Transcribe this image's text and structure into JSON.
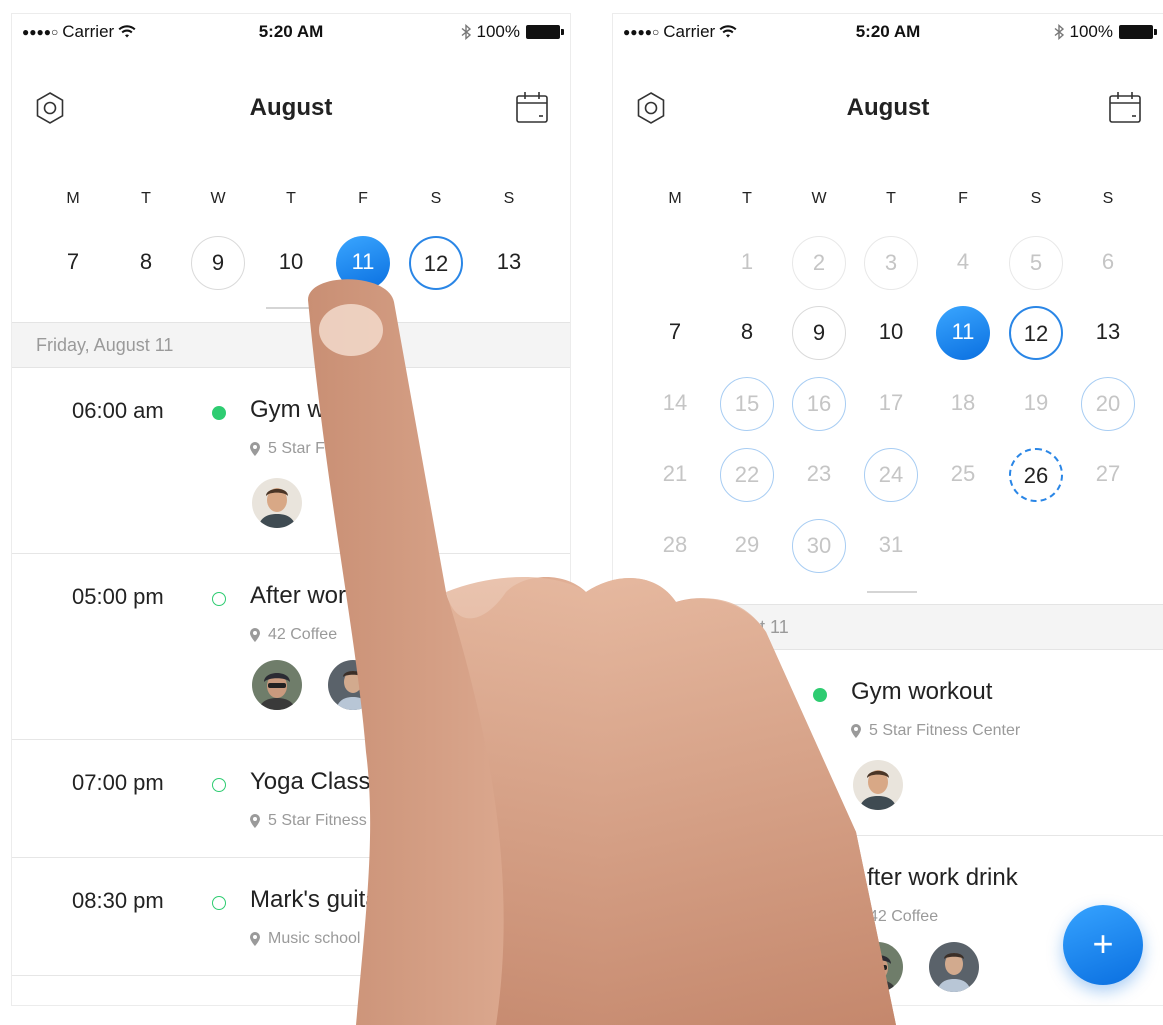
{
  "status_bar": {
    "signal_dots": "●●●●○",
    "carrier": "Carrier",
    "time": "5:20 AM",
    "battery": "100%"
  },
  "nav": {
    "title": "August",
    "left_icon": "settings-hexagon-icon",
    "right_icon": "calendar-icon"
  },
  "weekdays": [
    "M",
    "T",
    "W",
    "T",
    "F",
    "S",
    "S"
  ],
  "left_screen": {
    "week_days": [
      "7",
      "8",
      "9",
      "10",
      "11",
      "12",
      "13"
    ],
    "section_header": "Friday, August 11",
    "events": [
      {
        "time": "06:00 am",
        "title": "Gym workout",
        "location": "5 Star Fitness Center",
        "status": "confirmed"
      },
      {
        "time": "05:00 pm",
        "title": "After work drink",
        "location": "42 Coffee",
        "status": "pending"
      },
      {
        "time": "07:00 pm",
        "title": "Yoga Class",
        "location": "5 Star Fitness Center",
        "status": "pending"
      },
      {
        "time": "08:30 pm",
        "title": "Mark's guitar lesson",
        "location": "Music school",
        "status": "pending"
      }
    ]
  },
  "right_screen": {
    "month_days": [
      [
        "",
        "1",
        "2",
        "3",
        "4",
        "5",
        "6"
      ],
      [
        "7",
        "8",
        "9",
        "10",
        "11",
        "12",
        "13"
      ],
      [
        "14",
        "15",
        "16",
        "17",
        "18",
        "19",
        "20"
      ],
      [
        "21",
        "22",
        "23",
        "24",
        "25",
        "26",
        "27"
      ],
      [
        "28",
        "29",
        "30",
        "31",
        "",
        "",
        ""
      ]
    ],
    "section_header": "August 11",
    "events": [
      {
        "time": "06:00 am",
        "title": "Gym workout",
        "location": "5 Star Fitness Center"
      },
      {
        "time": "05:00 pm",
        "title": "After work drink",
        "location": "42 Coffee"
      }
    ],
    "fab_label": "+"
  },
  "colors": {
    "accent_blue": "#2a86e6",
    "event_green": "#2ecc71",
    "muted_gray": "#c5c5c5"
  }
}
